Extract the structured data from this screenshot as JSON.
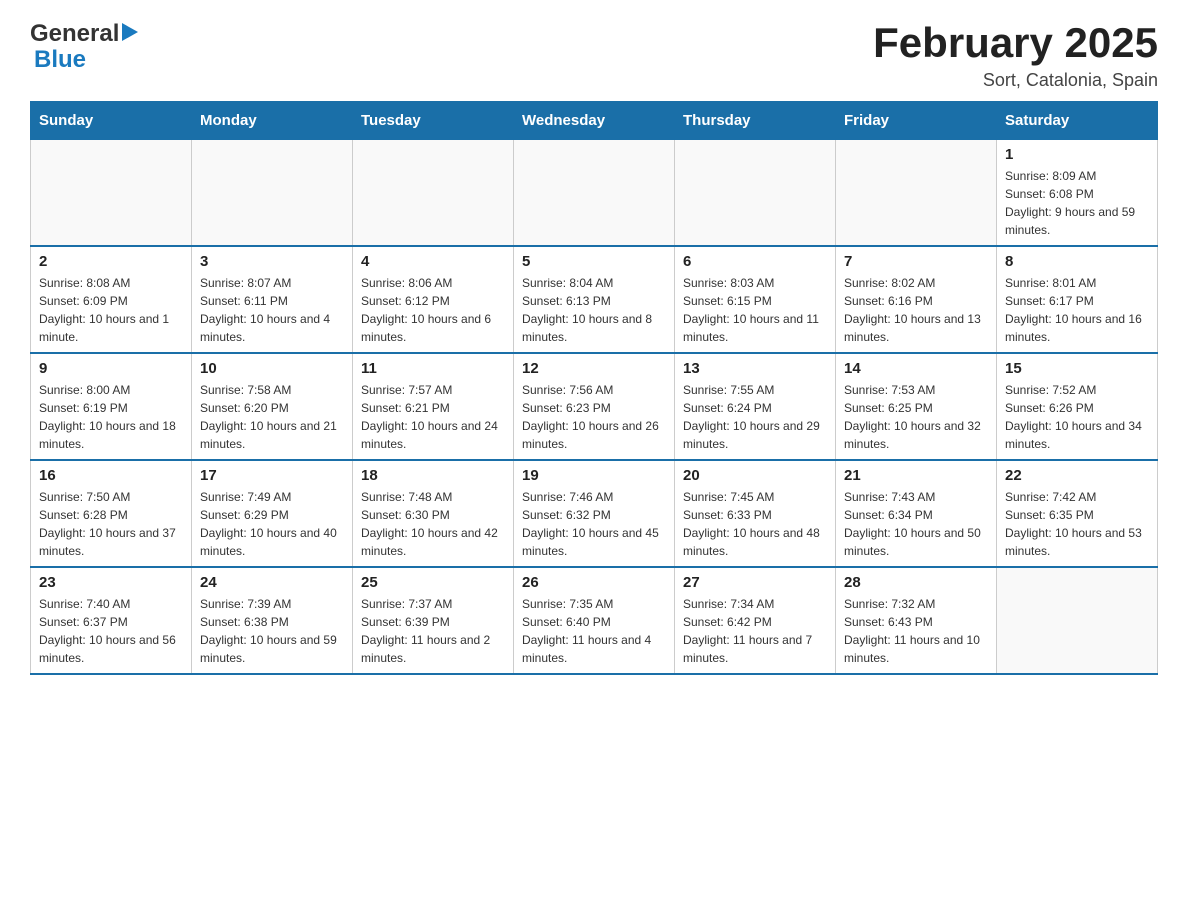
{
  "header": {
    "logo_general": "General",
    "logo_blue": "Blue",
    "month_title": "February 2025",
    "location": "Sort, Catalonia, Spain"
  },
  "days_of_week": [
    "Sunday",
    "Monday",
    "Tuesday",
    "Wednesday",
    "Thursday",
    "Friday",
    "Saturday"
  ],
  "weeks": [
    {
      "days": [
        {
          "number": "",
          "info": ""
        },
        {
          "number": "",
          "info": ""
        },
        {
          "number": "",
          "info": ""
        },
        {
          "number": "",
          "info": ""
        },
        {
          "number": "",
          "info": ""
        },
        {
          "number": "",
          "info": ""
        },
        {
          "number": "1",
          "info": "Sunrise: 8:09 AM\nSunset: 6:08 PM\nDaylight: 9 hours and 59 minutes."
        }
      ]
    },
    {
      "days": [
        {
          "number": "2",
          "info": "Sunrise: 8:08 AM\nSunset: 6:09 PM\nDaylight: 10 hours and 1 minute."
        },
        {
          "number": "3",
          "info": "Sunrise: 8:07 AM\nSunset: 6:11 PM\nDaylight: 10 hours and 4 minutes."
        },
        {
          "number": "4",
          "info": "Sunrise: 8:06 AM\nSunset: 6:12 PM\nDaylight: 10 hours and 6 minutes."
        },
        {
          "number": "5",
          "info": "Sunrise: 8:04 AM\nSunset: 6:13 PM\nDaylight: 10 hours and 8 minutes."
        },
        {
          "number": "6",
          "info": "Sunrise: 8:03 AM\nSunset: 6:15 PM\nDaylight: 10 hours and 11 minutes."
        },
        {
          "number": "7",
          "info": "Sunrise: 8:02 AM\nSunset: 6:16 PM\nDaylight: 10 hours and 13 minutes."
        },
        {
          "number": "8",
          "info": "Sunrise: 8:01 AM\nSunset: 6:17 PM\nDaylight: 10 hours and 16 minutes."
        }
      ]
    },
    {
      "days": [
        {
          "number": "9",
          "info": "Sunrise: 8:00 AM\nSunset: 6:19 PM\nDaylight: 10 hours and 18 minutes."
        },
        {
          "number": "10",
          "info": "Sunrise: 7:58 AM\nSunset: 6:20 PM\nDaylight: 10 hours and 21 minutes."
        },
        {
          "number": "11",
          "info": "Sunrise: 7:57 AM\nSunset: 6:21 PM\nDaylight: 10 hours and 24 minutes."
        },
        {
          "number": "12",
          "info": "Sunrise: 7:56 AM\nSunset: 6:23 PM\nDaylight: 10 hours and 26 minutes."
        },
        {
          "number": "13",
          "info": "Sunrise: 7:55 AM\nSunset: 6:24 PM\nDaylight: 10 hours and 29 minutes."
        },
        {
          "number": "14",
          "info": "Sunrise: 7:53 AM\nSunset: 6:25 PM\nDaylight: 10 hours and 32 minutes."
        },
        {
          "number": "15",
          "info": "Sunrise: 7:52 AM\nSunset: 6:26 PM\nDaylight: 10 hours and 34 minutes."
        }
      ]
    },
    {
      "days": [
        {
          "number": "16",
          "info": "Sunrise: 7:50 AM\nSunset: 6:28 PM\nDaylight: 10 hours and 37 minutes."
        },
        {
          "number": "17",
          "info": "Sunrise: 7:49 AM\nSunset: 6:29 PM\nDaylight: 10 hours and 40 minutes."
        },
        {
          "number": "18",
          "info": "Sunrise: 7:48 AM\nSunset: 6:30 PM\nDaylight: 10 hours and 42 minutes."
        },
        {
          "number": "19",
          "info": "Sunrise: 7:46 AM\nSunset: 6:32 PM\nDaylight: 10 hours and 45 minutes."
        },
        {
          "number": "20",
          "info": "Sunrise: 7:45 AM\nSunset: 6:33 PM\nDaylight: 10 hours and 48 minutes."
        },
        {
          "number": "21",
          "info": "Sunrise: 7:43 AM\nSunset: 6:34 PM\nDaylight: 10 hours and 50 minutes."
        },
        {
          "number": "22",
          "info": "Sunrise: 7:42 AM\nSunset: 6:35 PM\nDaylight: 10 hours and 53 minutes."
        }
      ]
    },
    {
      "days": [
        {
          "number": "23",
          "info": "Sunrise: 7:40 AM\nSunset: 6:37 PM\nDaylight: 10 hours and 56 minutes."
        },
        {
          "number": "24",
          "info": "Sunrise: 7:39 AM\nSunset: 6:38 PM\nDaylight: 10 hours and 59 minutes."
        },
        {
          "number": "25",
          "info": "Sunrise: 7:37 AM\nSunset: 6:39 PM\nDaylight: 11 hours and 2 minutes."
        },
        {
          "number": "26",
          "info": "Sunrise: 7:35 AM\nSunset: 6:40 PM\nDaylight: 11 hours and 4 minutes."
        },
        {
          "number": "27",
          "info": "Sunrise: 7:34 AM\nSunset: 6:42 PM\nDaylight: 11 hours and 7 minutes."
        },
        {
          "number": "28",
          "info": "Sunrise: 7:32 AM\nSunset: 6:43 PM\nDaylight: 11 hours and 10 minutes."
        },
        {
          "number": "",
          "info": ""
        }
      ]
    }
  ]
}
